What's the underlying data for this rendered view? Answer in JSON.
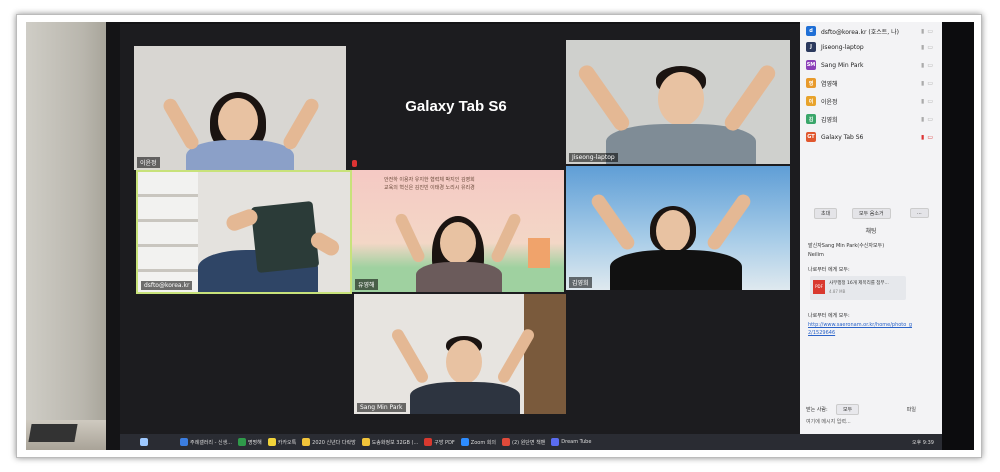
{
  "meeting": {
    "center_tile_title": "Galaxy Tab S6",
    "tiles": [
      {
        "label": "이윤정"
      },
      {
        "label": ""
      },
      {
        "label": "Jiseong-laptop"
      },
      {
        "label": "dsfto@korea.kr"
      },
      {
        "label": "유영해"
      },
      {
        "label": "김영희"
      },
      {
        "label": "Sang Min Park"
      }
    ],
    "card_text": [
      "안전하 이용자 유지한 협력체 박지인 김영희",
      "교육의 혁신은 김진빈 이태경 노리시 유리경"
    ]
  },
  "participants": [
    {
      "initial": "d",
      "name": "dsfto@korea.kr (호스트, 나)",
      "color": "#1f6fd6"
    },
    {
      "initial": "J",
      "name": "Jiseong-laptop",
      "color": "#2c3a5e"
    },
    {
      "initial": "SM",
      "name": "Sang Min Park",
      "color": "#8a3fb8"
    },
    {
      "initial": "영",
      "name": "염영해",
      "color": "#e89a2c"
    },
    {
      "initial": "이",
      "name": "이윤정",
      "color": "#e8a32c"
    },
    {
      "initial": "김",
      "name": "김영희",
      "color": "#3aa66a"
    },
    {
      "initial": "GT",
      "name": "Galaxy Tab S6",
      "color": "#e0572e"
    }
  ],
  "panel": {
    "invite_label": "초대",
    "mute_all_label": "모두 음소거",
    "more_label": "...",
    "chat_header": "채팅",
    "chat_messages": [
      {
        "from": "발신자Sang Min Park(수신자모두)",
        "text": "Neilim"
      },
      {
        "from": "나로부터 에게 모두:",
        "text": "사무행정 16개 제목리를 첨부..."
      },
      {
        "from": "나로부터 에게 모두:",
        "text": "http://www.saeronam.or.kr/home/photo_g",
        "text2": "2/1529646"
      }
    ],
    "file_size": "4.87 MB",
    "to_label": "받는 사람:",
    "to_value": "모두",
    "file_label": "파일",
    "input_placeholder": "여기에 메시지 입력..."
  },
  "taskbar": {
    "items": [
      "주례갤러리 - 신생...",
      "명명해",
      "카카오톡",
      "2020 신년다 다락방",
      "도송화정보 32GB (...",
      "구방 PDF",
      "Zoom 회의",
      "(2) 원단면 책밴",
      "Dream Tube"
    ],
    "clock": "오후 9:39"
  },
  "colors": {
    "active_speaker": "#c8e27a",
    "panel_bg": "#f3f3f5"
  }
}
